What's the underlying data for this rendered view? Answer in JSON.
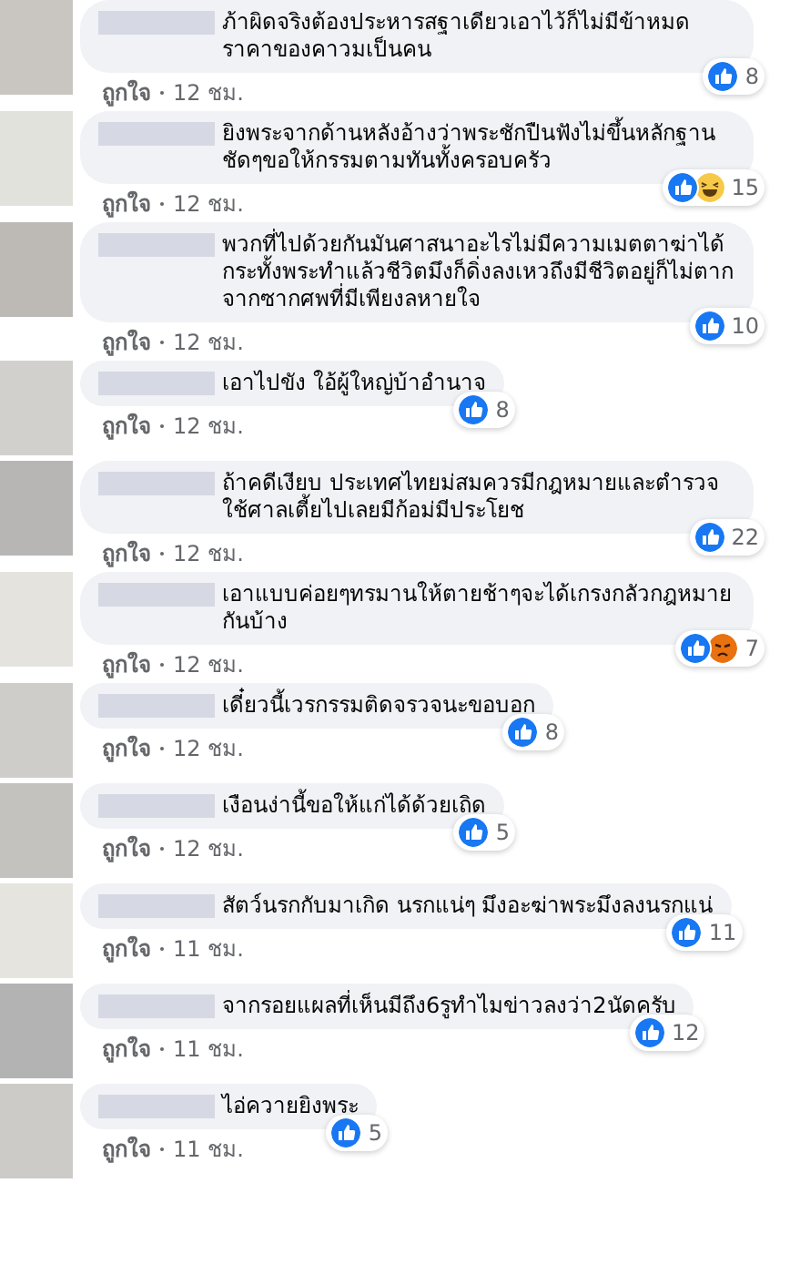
{
  "comments": [
    {
      "text": "ภ้าผิดจริงต้องประหารสฐาเดียวเอาไว้ก็ไม่มีข้าหมดราคาของคาวมเป็นคน",
      "reactions": [
        {
          "kind": "like"
        }
      ],
      "count": "8",
      "action": "ถูกใจ",
      "time": "12 ชม."
    },
    {
      "text": "ยิงพระจากด้านหลังอ้างว่าพระชักปืนฟังไม่ขึ้นหลักฐานชัดๆขอให้กรรมตามทันทั้งครอบครัว",
      "reactions": [
        {
          "kind": "like"
        },
        {
          "kind": "haha"
        }
      ],
      "count": "15",
      "action": "ถูกใจ",
      "time": "12 ชม."
    },
    {
      "text": "พวกที่ไปด้วยกันมันศาสนาอะไรไม่มีความเมตตาฆ่าได้กระทั้งพระทำแล้วชีวิตมึงก็ดิ่งลงเหวถึงมีชีวิตอยู่ก็ไม่ตากจากซากศพที่มีเพียงลหายใจ",
      "reactions": [
        {
          "kind": "like"
        }
      ],
      "count": "10",
      "action": "ถูกใจ",
      "time": "12 ชม."
    },
    {
      "text": "เอาไปขัง ใอ้ผู้ใหญ่บ้าอำนาจ",
      "reactions": [
        {
          "kind": "like"
        }
      ],
      "count": "8",
      "action": "ถูกใจ",
      "time": "12 ชม."
    },
    {
      "text": "ถ้าคดีเงียบ ประเทศไทยม่สมควรมีกฎหมายและตำรวจ ใช้ศาลเตี้ยไปเลยมีก้อม่มีประโยช",
      "reactions": [
        {
          "kind": "like"
        }
      ],
      "count": "22",
      "action": "ถูกใจ",
      "time": "12 ชม."
    },
    {
      "text": "เอาแบบค่อยๆทรมานให้ตายช้าๆจะได้เกรงกลัวกฎหมายกันบ้าง",
      "reactions": [
        {
          "kind": "like"
        },
        {
          "kind": "angry"
        }
      ],
      "count": "7",
      "action": "ถูกใจ",
      "time": "12 ชม."
    },
    {
      "text": "เดี๋ยวนี้เวรกรรมติดจรวจนะขอบอก",
      "reactions": [
        {
          "kind": "like"
        }
      ],
      "count": "8",
      "action": "ถูกใจ",
      "time": "12 ชม."
    },
    {
      "text": "เงือนง่านี้ขอให้แก่ได้ด้วยเถิด",
      "reactions": [
        {
          "kind": "like"
        }
      ],
      "count": "5",
      "action": "ถูกใจ",
      "time": "12 ชม."
    },
    {
      "text": "สัตว์นรกกับมาเกิด นรกแน่ๆ มึงอะฆ่าพระมึงลงนรกแน่",
      "reactions": [
        {
          "kind": "like"
        }
      ],
      "count": "11",
      "action": "ถูกใจ",
      "time": "11 ชม."
    },
    {
      "text": "จากรอยแผลที่เห็นมีถึง6รูทำไมข่าวลงว่า2นัดครับ",
      "reactions": [
        {
          "kind": "like"
        }
      ],
      "count": "12",
      "action": "ถูกใจ",
      "time": "11 ชม."
    },
    {
      "text": "ไอ่ควายยิงพระ",
      "reactions": [
        {
          "kind": "like"
        }
      ],
      "count": "5",
      "action": "ถูกใจ",
      "time": "11 ชม."
    }
  ]
}
